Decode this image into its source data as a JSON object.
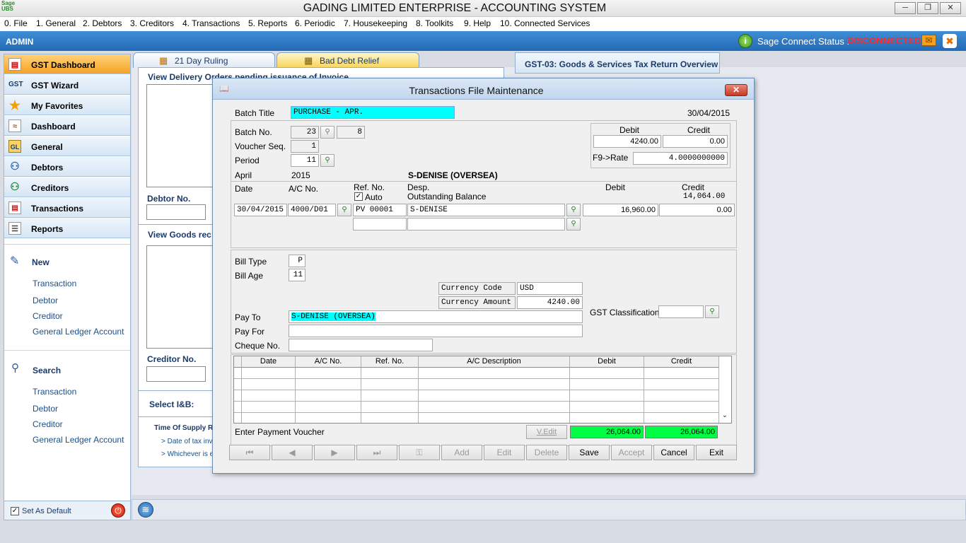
{
  "app": {
    "title": "GADING LIMITED ENTERPRISE - ACCOUNTING SYSTEM",
    "logo_text": "Sage",
    "logo_sub": "UBS"
  },
  "menu": [
    "0. File",
    "1. General",
    "2. Debtors",
    "3. Creditors",
    "4. Transactions",
    "5. Reports",
    "6. Periodic",
    "7. Housekeeping",
    "8. Toolkits",
    "9. Help",
    "10. Connected Services"
  ],
  "userbar": {
    "user": "ADMIN",
    "status_label": "Sage Connect Status :",
    "status_value": "DISCONNECTED"
  },
  "sidebar": {
    "items": [
      {
        "label": "GST Dashboard",
        "icon": "chart-icon"
      },
      {
        "label": "GST Wizard",
        "icon": "gst-icon"
      },
      {
        "label": "My Favorites",
        "icon": "star-icon"
      },
      {
        "label": "Dashboard",
        "icon": "dashboard-icon"
      },
      {
        "label": "General",
        "icon": "gl-icon"
      },
      {
        "label": "Debtors",
        "icon": "debtors-icon"
      },
      {
        "label": "Creditors",
        "icon": "creditors-icon"
      },
      {
        "label": "Transactions",
        "icon": "transactions-icon"
      },
      {
        "label": "Reports",
        "icon": "reports-icon"
      }
    ],
    "new_label": "New",
    "new_links": [
      "Transaction",
      "Debtor",
      "Creditor",
      "General Ledger Account"
    ],
    "search_label": "Search",
    "search_links": [
      "Transaction",
      "Debtor",
      "Creditor",
      "General Ledger Account"
    ],
    "footer_label": "Set As Default"
  },
  "dashboard": {
    "tabs": [
      "21 Day Ruling",
      "Bad Debt Relief"
    ],
    "delivery_title": "View Delivery Orders pending issuance of Invoice",
    "debtor_no_label": "Debtor No.",
    "goods_title": "View Goods rec",
    "creditor_no_label": "Creditor No.",
    "select_label": "Select I&B:",
    "supply_title": "Time Of Supply R",
    "supply_line1": "> Date of tax invo",
    "supply_line2": "> Whichever is e",
    "gst_header": "GST-03: Goods & Services Tax Return Overview"
  },
  "dialog": {
    "title": "Transactions File Maintenance",
    "batch_title_label": "Batch Title",
    "batch_title_value": "PURCHASE - APR.",
    "date_value": "30/04/2015",
    "batch_no_label": "Batch No.",
    "batch_no_value": "23",
    "batch_no_suffix": "8",
    "voucher_seq_label": "Voucher Seq.",
    "voucher_seq_value": "1",
    "period_label": "Period",
    "period_value": "11",
    "debit_label": "Debit",
    "credit_label": "Credit",
    "summary_debit": "4240.00",
    "summary_credit": "0.00",
    "rate_label": "F9->Rate",
    "rate_value": "4.0000000000",
    "month_label": "April",
    "year_label": "2015",
    "party_name": "S-DENISE (OVERSEA)",
    "col_date": "Date",
    "col_acno": "A/C No.",
    "col_refno": "Ref. No.",
    "auto_label": "Auto",
    "col_desp": "Desp.",
    "outstanding_label": "Outstanding Balance",
    "col_debit": "Debit",
    "col_credit": "Credit",
    "outstanding_value": "14,064.00",
    "entry_date": "30/04/2015",
    "entry_acno": "4000/D01",
    "entry_refno": "PV 00001",
    "entry_desp": "S-DENISE",
    "entry_debit": "16,960.00",
    "entry_credit": "0.00",
    "bill_type_label": "Bill Type",
    "bill_type_value": "P",
    "bill_age_label": "Bill Age",
    "bill_age_value": "11",
    "currency_code_label": "Currency Code",
    "currency_code_value": "USD",
    "currency_amount_label": "Currency Amount",
    "currency_amount_value": "4240.00",
    "gst_class_label": "GST Classification",
    "pay_to_label": "Pay To",
    "pay_to_value": "S-DENISE (OVERSEA)",
    "pay_for_label": "Pay For",
    "cheque_label": "Cheque No.",
    "grid_headers": [
      "Date",
      "A/C No.",
      "Ref. No.",
      "A/C Description",
      "Debit",
      "Credit"
    ],
    "status_text": "Enter Payment Voucher",
    "vedit_label": "V.Edit",
    "total_debit": "26,064.00",
    "total_credit": "26,064.00",
    "buttons": {
      "add": "Add",
      "edit": "Edit",
      "delete": "Delete",
      "save": "Save",
      "accept": "Accept",
      "cancel": "Cancel",
      "exit": "Exit"
    }
  },
  "colors": {
    "accent": "#2469b4",
    "highlight_field": "#00ffff",
    "total_field": "#00ff44",
    "disconnected": "#ff2a2a"
  }
}
